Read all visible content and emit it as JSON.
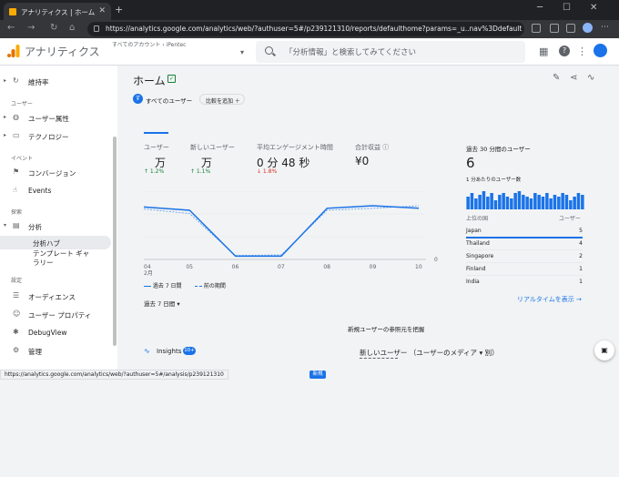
{
  "browser": {
    "tab_title": "アナリティクス | ホーム",
    "tab_close": "✕",
    "new_tab": "+",
    "url": "https://analytics.google.com/analytics/web/?authuser=5#/p239121310/reports/defaulthome?params=_u..nav%3Ddefault",
    "status_url": "https://analytics.google.com/analytics/web/?authuser=5#/analysis/p239121310"
  },
  "header": {
    "app_title": "アナリティクス",
    "breadcrumb": "すべてのアカウント › iPentec",
    "property": "iPentec",
    "search_placeholder": "「分析情報」と検索してみてください",
    "colors": {
      "logo_orange": "#f9ab00",
      "logo_dark": "#e37400"
    }
  },
  "sidebar": {
    "items": [
      {
        "label": "維持率",
        "icon": "retention-icon"
      },
      {
        "label": "ユーザー属性",
        "icon": "globe-icon"
      },
      {
        "label": "テクノロジー",
        "icon": "devices-icon"
      },
      {
        "label": "コンバージョン",
        "icon": "flag-icon"
      },
      {
        "label": "Events",
        "icon": "touch-icon"
      },
      {
        "label": "分析",
        "icon": "explore-icon"
      },
      {
        "label": "分析ハブ"
      },
      {
        "label": "テンプレート ギャ\nラリー"
      },
      {
        "label": "オーディエンス",
        "icon": "audience-icon"
      },
      {
        "label": "ユーザー プロパティ",
        "icon": "user-property-icon"
      },
      {
        "label": "DebugView",
        "icon": "debug-icon"
      },
      {
        "label": "管理",
        "icon": "gear-icon"
      }
    ],
    "sections": {
      "user": "ユーザー",
      "event": "イベント",
      "explore": "探索",
      "settings": "設定"
    }
  },
  "main": {
    "title": "ホーム",
    "chip_all_users": "すべてのユーザー",
    "chip_avatar": "す",
    "compare_label": "比較を追加 ＋",
    "metrics": [
      {
        "label": "ユーザー",
        "value": "万",
        "change": "↑ 1.2%",
        "trend": "up"
      },
      {
        "label": "新しいユーザー",
        "value": "万",
        "change": "↑ 1.1%",
        "trend": "up"
      },
      {
        "label": "平均エンゲージメント時間",
        "value": "0 分 48 秒",
        "change": "↓ 1.8%",
        "trend": "down"
      },
      {
        "label": "合計収益 ⓘ",
        "value": "¥0",
        "change": "",
        "trend": "none"
      }
    ],
    "legend_current": "過去 7 日間",
    "legend_previous": "前の期間",
    "period_selector": "過去 7 日間 ▾",
    "section_label": "新規ユーザーの参照元を把握",
    "insights_title": "Insights",
    "insights_count": "10+",
    "new_badge": "新規",
    "new_users_card": "新しいユーザー （ユーザーのメディア ▾ 別）",
    "colors": {
      "accent": "#1a73e8",
      "up": "#188038",
      "down": "#d93025"
    }
  },
  "chart_data": {
    "type": "line",
    "x": [
      "04\n2月",
      "05",
      "06",
      "07",
      "08",
      "09",
      "10"
    ],
    "series": [
      {
        "name": "過去 7 日間",
        "values": [
          0.8,
          0.75,
          0.05,
          0.05,
          0.78,
          0.82,
          0.78
        ]
      },
      {
        "name": "前の期間",
        "values": [
          0.77,
          0.7,
          0.06,
          0.07,
          0.75,
          0.78,
          0.82
        ]
      }
    ],
    "y_zero_label": "0",
    "ylim": [
      0,
      1
    ]
  },
  "realtime": {
    "title": "過去 30 分間のユーザー",
    "value": "6",
    "per_minute": "1 分あたりのユーザー数",
    "bars": [
      0.7,
      0.9,
      0.6,
      0.8,
      1,
      0.7,
      0.9,
      0.5,
      0.8,
      0.9,
      0.7,
      0.6,
      0.9,
      1,
      0.8,
      0.7,
      0.6,
      0.9,
      0.8,
      0.7,
      0.9,
      0.6,
      0.8,
      0.7,
      0.9,
      0.8,
      0.5,
      0.7,
      0.9,
      0.8
    ],
    "col_country": "上位の国",
    "col_users": "ユーザー",
    "rows": [
      {
        "country": "Japan",
        "users": "5"
      },
      {
        "country": "Thailand",
        "users": "4"
      },
      {
        "country": "Singapore",
        "users": "2"
      },
      {
        "country": "Finland",
        "users": "1"
      },
      {
        "country": "India",
        "users": "1"
      }
    ],
    "link": "リアルタイムを表示 →"
  }
}
